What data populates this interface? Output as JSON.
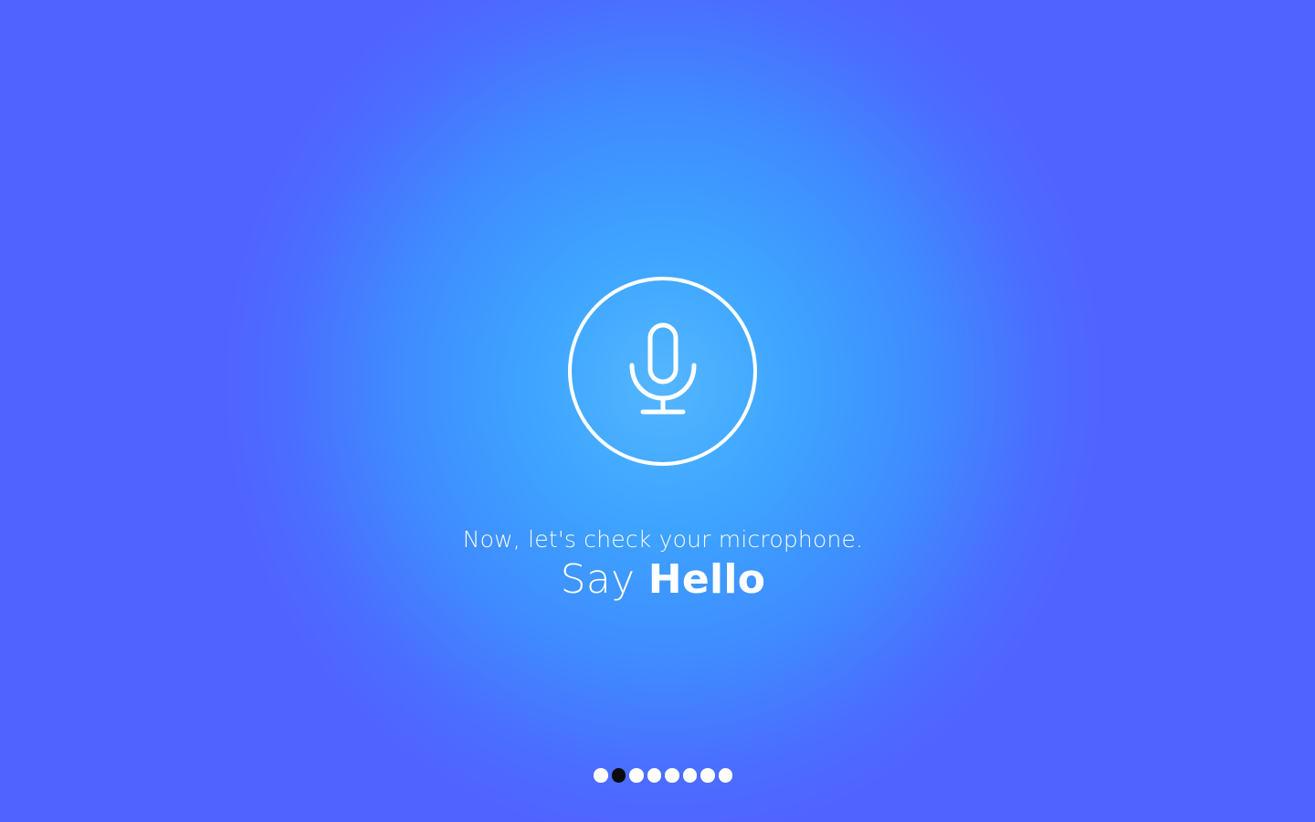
{
  "screen": {
    "subtitle": "Now, let's check your microphone.",
    "title_prefix": "Say",
    "title_emphasis": "Hello",
    "icon": "microphone-icon"
  },
  "pagination": {
    "total_steps": 8,
    "current_step": 2
  },
  "colors": {
    "background_outer": "#5163ff",
    "background_center": "#55b6ff",
    "foreground": "#ffffff",
    "active_dot": "#0b0b0b"
  }
}
